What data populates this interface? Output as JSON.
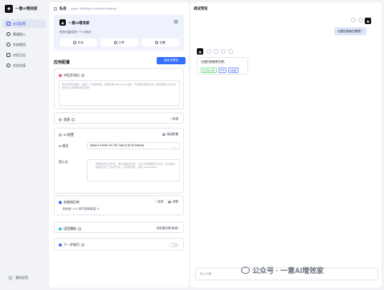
{
  "app": {
    "name": "一意AI增效家"
  },
  "sidebar": {
    "items": [
      {
        "label": "应用配置",
        "active": true
      },
      {
        "label": "渠道接入",
        "active": false
      },
      {
        "label": "外部使用",
        "active": false
      },
      {
        "label": "对话日志",
        "active": false
      },
      {
        "label": "应用对接",
        "active": false
      }
    ],
    "footer": "我的应用"
  },
  "config": {
    "header_title": "私有",
    "header_id": "(appid: 6f6f6f3a4b7a4d1f6b4c5b6b4b)",
    "agent": {
      "name": "一意AI增效家",
      "desc": "快来创建你的一个小助手~",
      "actions": [
        "对话",
        "分享",
        "设置"
      ]
    },
    "section_title": "应用配置",
    "save_label": "保存并预览",
    "prompt_box": {
      "title": "对话开场白",
      "placeholder": "每次对话开始前，发送一个初始内容。支持标准 Markdown 语法，可使用的额外标记: [快捷按钮]: 用户点击后可以直接发送该问题"
    },
    "variables": {
      "title": "变量",
      "add_label": "+ 新增"
    },
    "ai_config": {
      "title": "AI 配置",
      "advanced_label": "高级配置",
      "model_label": "AI 模型",
      "model_value": "Qwen1.5-MoE-A2.7B-Chat (0 元/1k tokens)",
      "prompt_label": "提示词",
      "prompt_placeholder": "模型固定的引导词，通过调整该内容，可以引导模型聊天方向。该内容会被固定在上下文的开头。可使用变量，例如 {{language}}"
    },
    "knowledge": {
      "title": "关联知识库",
      "select_label": "+ 选择",
      "param_label": "参数",
      "info": "相似度: 0.4, 单次搜索数量: 5"
    },
    "voice": {
      "title": "语音播报",
      "value": "浏览器自带(免费)"
    },
    "next_step": {
      "title": "下一步指引"
    }
  },
  "preview": {
    "title": "调试预览",
    "user_message": "法国的首都在哪里？",
    "bot_message": "法国的首都是巴黎。",
    "tags": [
      "上下文: 2 条",
      "0.1s",
      "AI对话"
    ],
    "input_placeholder": "输入问题"
  },
  "watermark": "公众号 · 一意AI增效家"
}
